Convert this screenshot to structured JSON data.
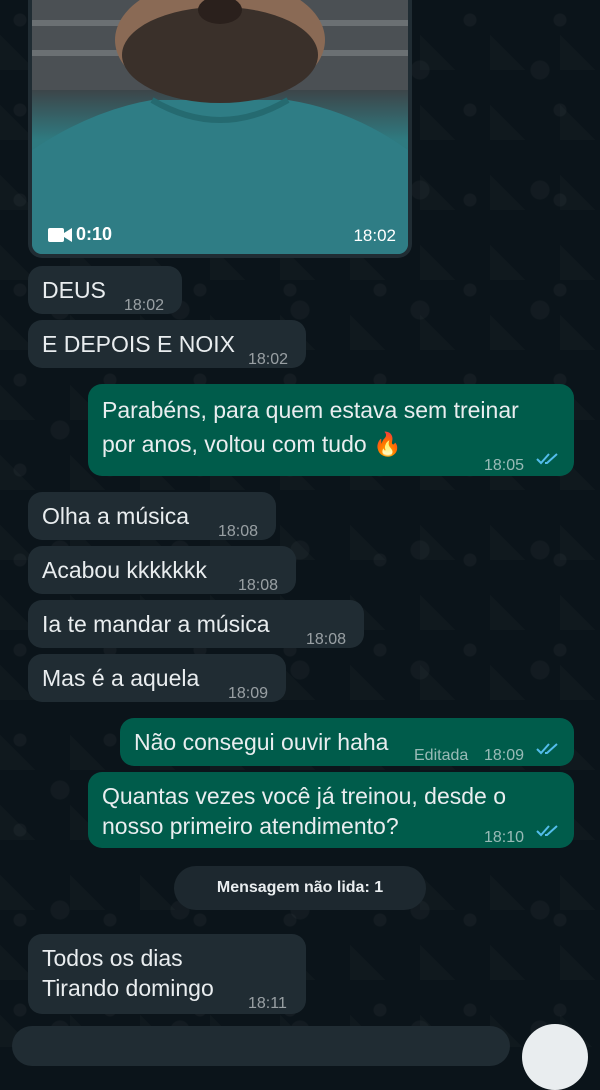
{
  "media_message": {
    "duration": "0:10",
    "time": "18:02"
  },
  "messages": [
    {
      "text": "DEUS",
      "time": "18:02"
    },
    {
      "text": "E DEPOIS E NOIX",
      "time": "18:02"
    },
    {
      "line1": "Parabéns, para quem estava sem treinar",
      "line2": "por anos, voltou com tudo 🔥",
      "time": "18:05"
    },
    {
      "text": "Olha a música",
      "time": "18:08"
    },
    {
      "text": "Acabou kkkkkkk",
      "time": "18:08"
    },
    {
      "text": "Ia te mandar a música",
      "time": "18:08"
    },
    {
      "text": "Mas é a aquela",
      "time": "18:09"
    },
    {
      "text": "Não consegui ouvir haha",
      "edited": "Editada",
      "time": "18:09"
    },
    {
      "line1": "Quantas vezes você já treinou, desde o",
      "line2": "nosso primeiro atendimento?",
      "time": "18:10"
    },
    {
      "line1": "Todos os dias",
      "line2": "Tirando domingo",
      "time": "18:11"
    }
  ],
  "unread_notice": "Mensagem não lida: 1",
  "colors": {
    "incoming": "#202c33",
    "outgoing": "#005c4b",
    "read_ticks": "#53bdeb"
  }
}
